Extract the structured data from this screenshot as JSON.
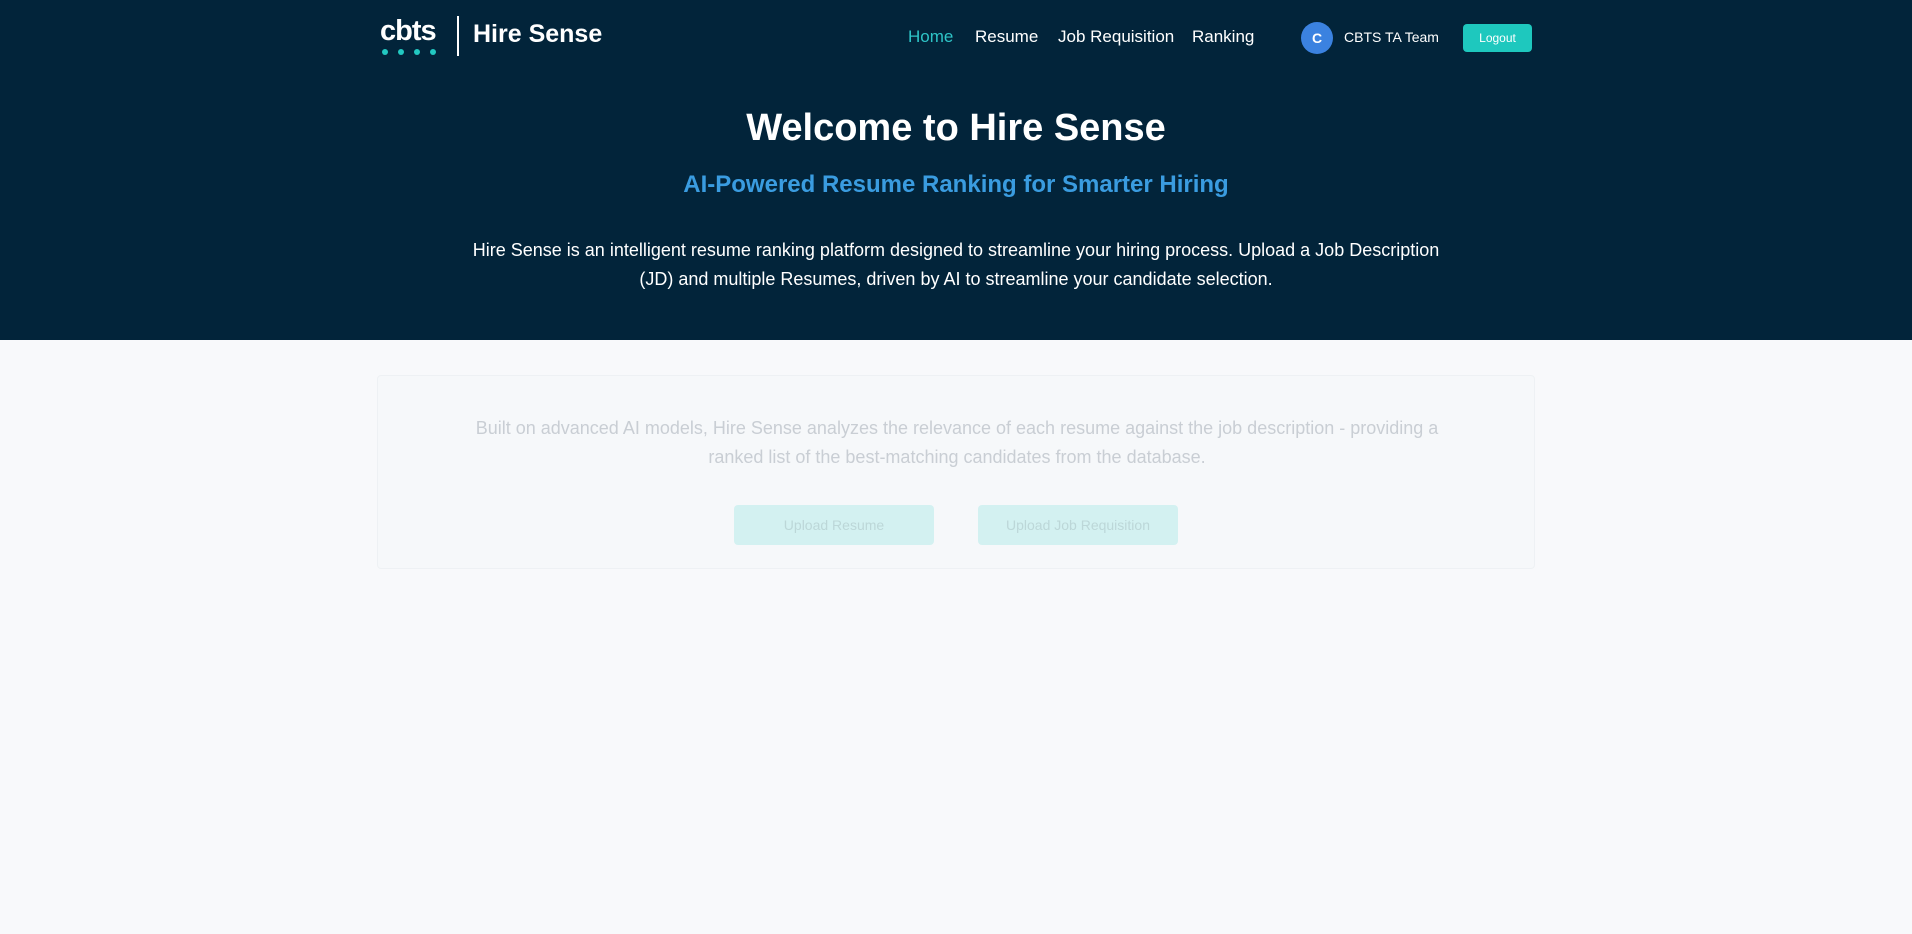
{
  "header": {
    "logo_text": "cbts",
    "brand_title": "Hire Sense",
    "nav": [
      {
        "label": "Home",
        "active": true
      },
      {
        "label": "Resume",
        "active": false
      },
      {
        "label": "Job Requisition",
        "active": false
      },
      {
        "label": "Ranking",
        "active": false
      }
    ],
    "user": {
      "avatar_initial": "C",
      "name": "CBTS TA Team"
    },
    "logout_label": "Logout"
  },
  "hero": {
    "title": "Welcome to Hire Sense",
    "subtitle": "AI-Powered Resume Ranking for Smarter Hiring",
    "description": "Hire Sense is an intelligent resume ranking platform designed to streamline your hiring process. Upload a Job Description (JD) and multiple Resumes, driven by AI to streamline your candidate selection."
  },
  "feature": {
    "text": "Built on advanced AI models, Hire Sense analyzes the relevance of each resume against the job description - providing a ranked list of the best-matching candidates from the database.",
    "upload_resume_label": "Upload Resume",
    "upload_jd_label": "Upload Job Requisition"
  },
  "colors": {
    "hero_bg": "#02243a",
    "accent": "#1ec8be",
    "subtitle": "#3a9ce0",
    "avatar": "#3b82e0",
    "page_bg": "#f8f9fb"
  }
}
